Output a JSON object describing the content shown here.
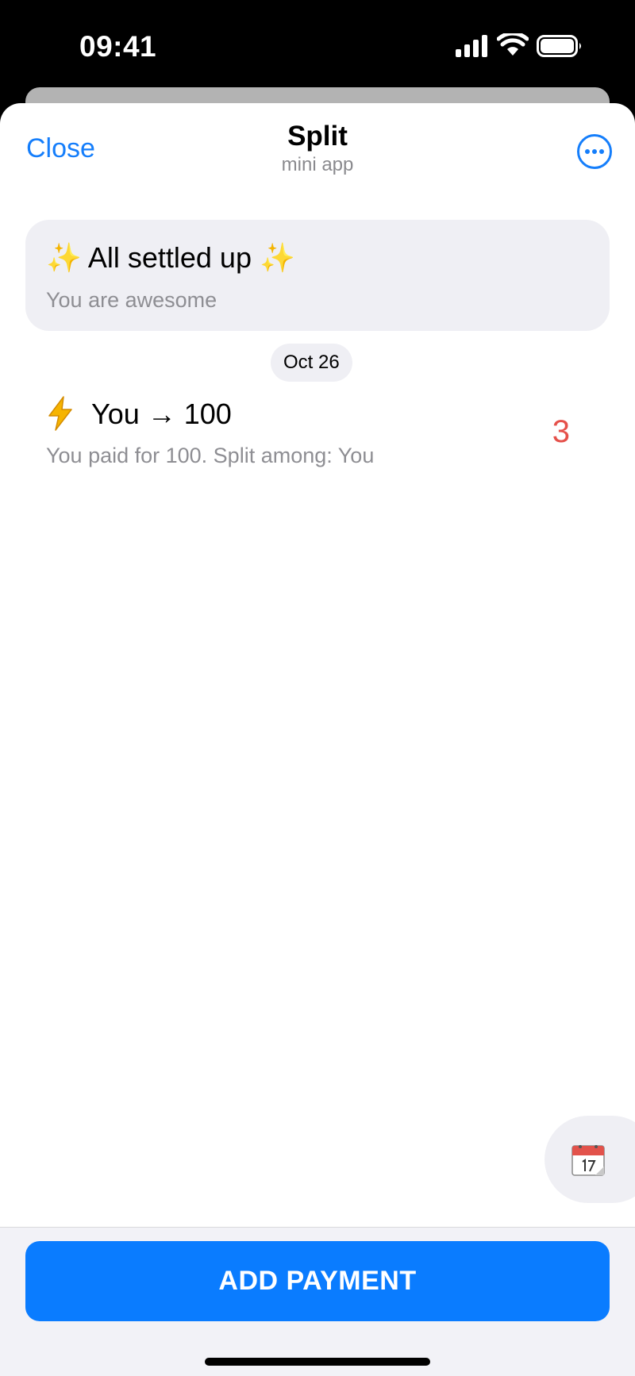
{
  "status_bar": {
    "time": "09:41",
    "icons": [
      "signal-icon",
      "wifi-icon",
      "battery-icon"
    ]
  },
  "nav": {
    "close_label": "Close",
    "title": "Split",
    "subtitle": "mini app",
    "more_icon": "more-icon"
  },
  "summary": {
    "title": "✨ All settled up ✨",
    "subtitle": "You are awesome"
  },
  "date_header": "Oct 26",
  "payments": [
    {
      "icon": "lightning-icon",
      "title": "You → 100",
      "subtitle": "You paid for 100. Split among: You",
      "amount": "3"
    }
  ],
  "calendar_button": {
    "icon": "calendar-icon"
  },
  "bottom": {
    "add_payment_label": "ADD PAYMENT"
  },
  "colors": {
    "accent": "#0a7cff",
    "link": "#157efb",
    "amount": "#e5504a",
    "card_bg": "#efeff4",
    "secondary_text": "#8e8e93"
  }
}
